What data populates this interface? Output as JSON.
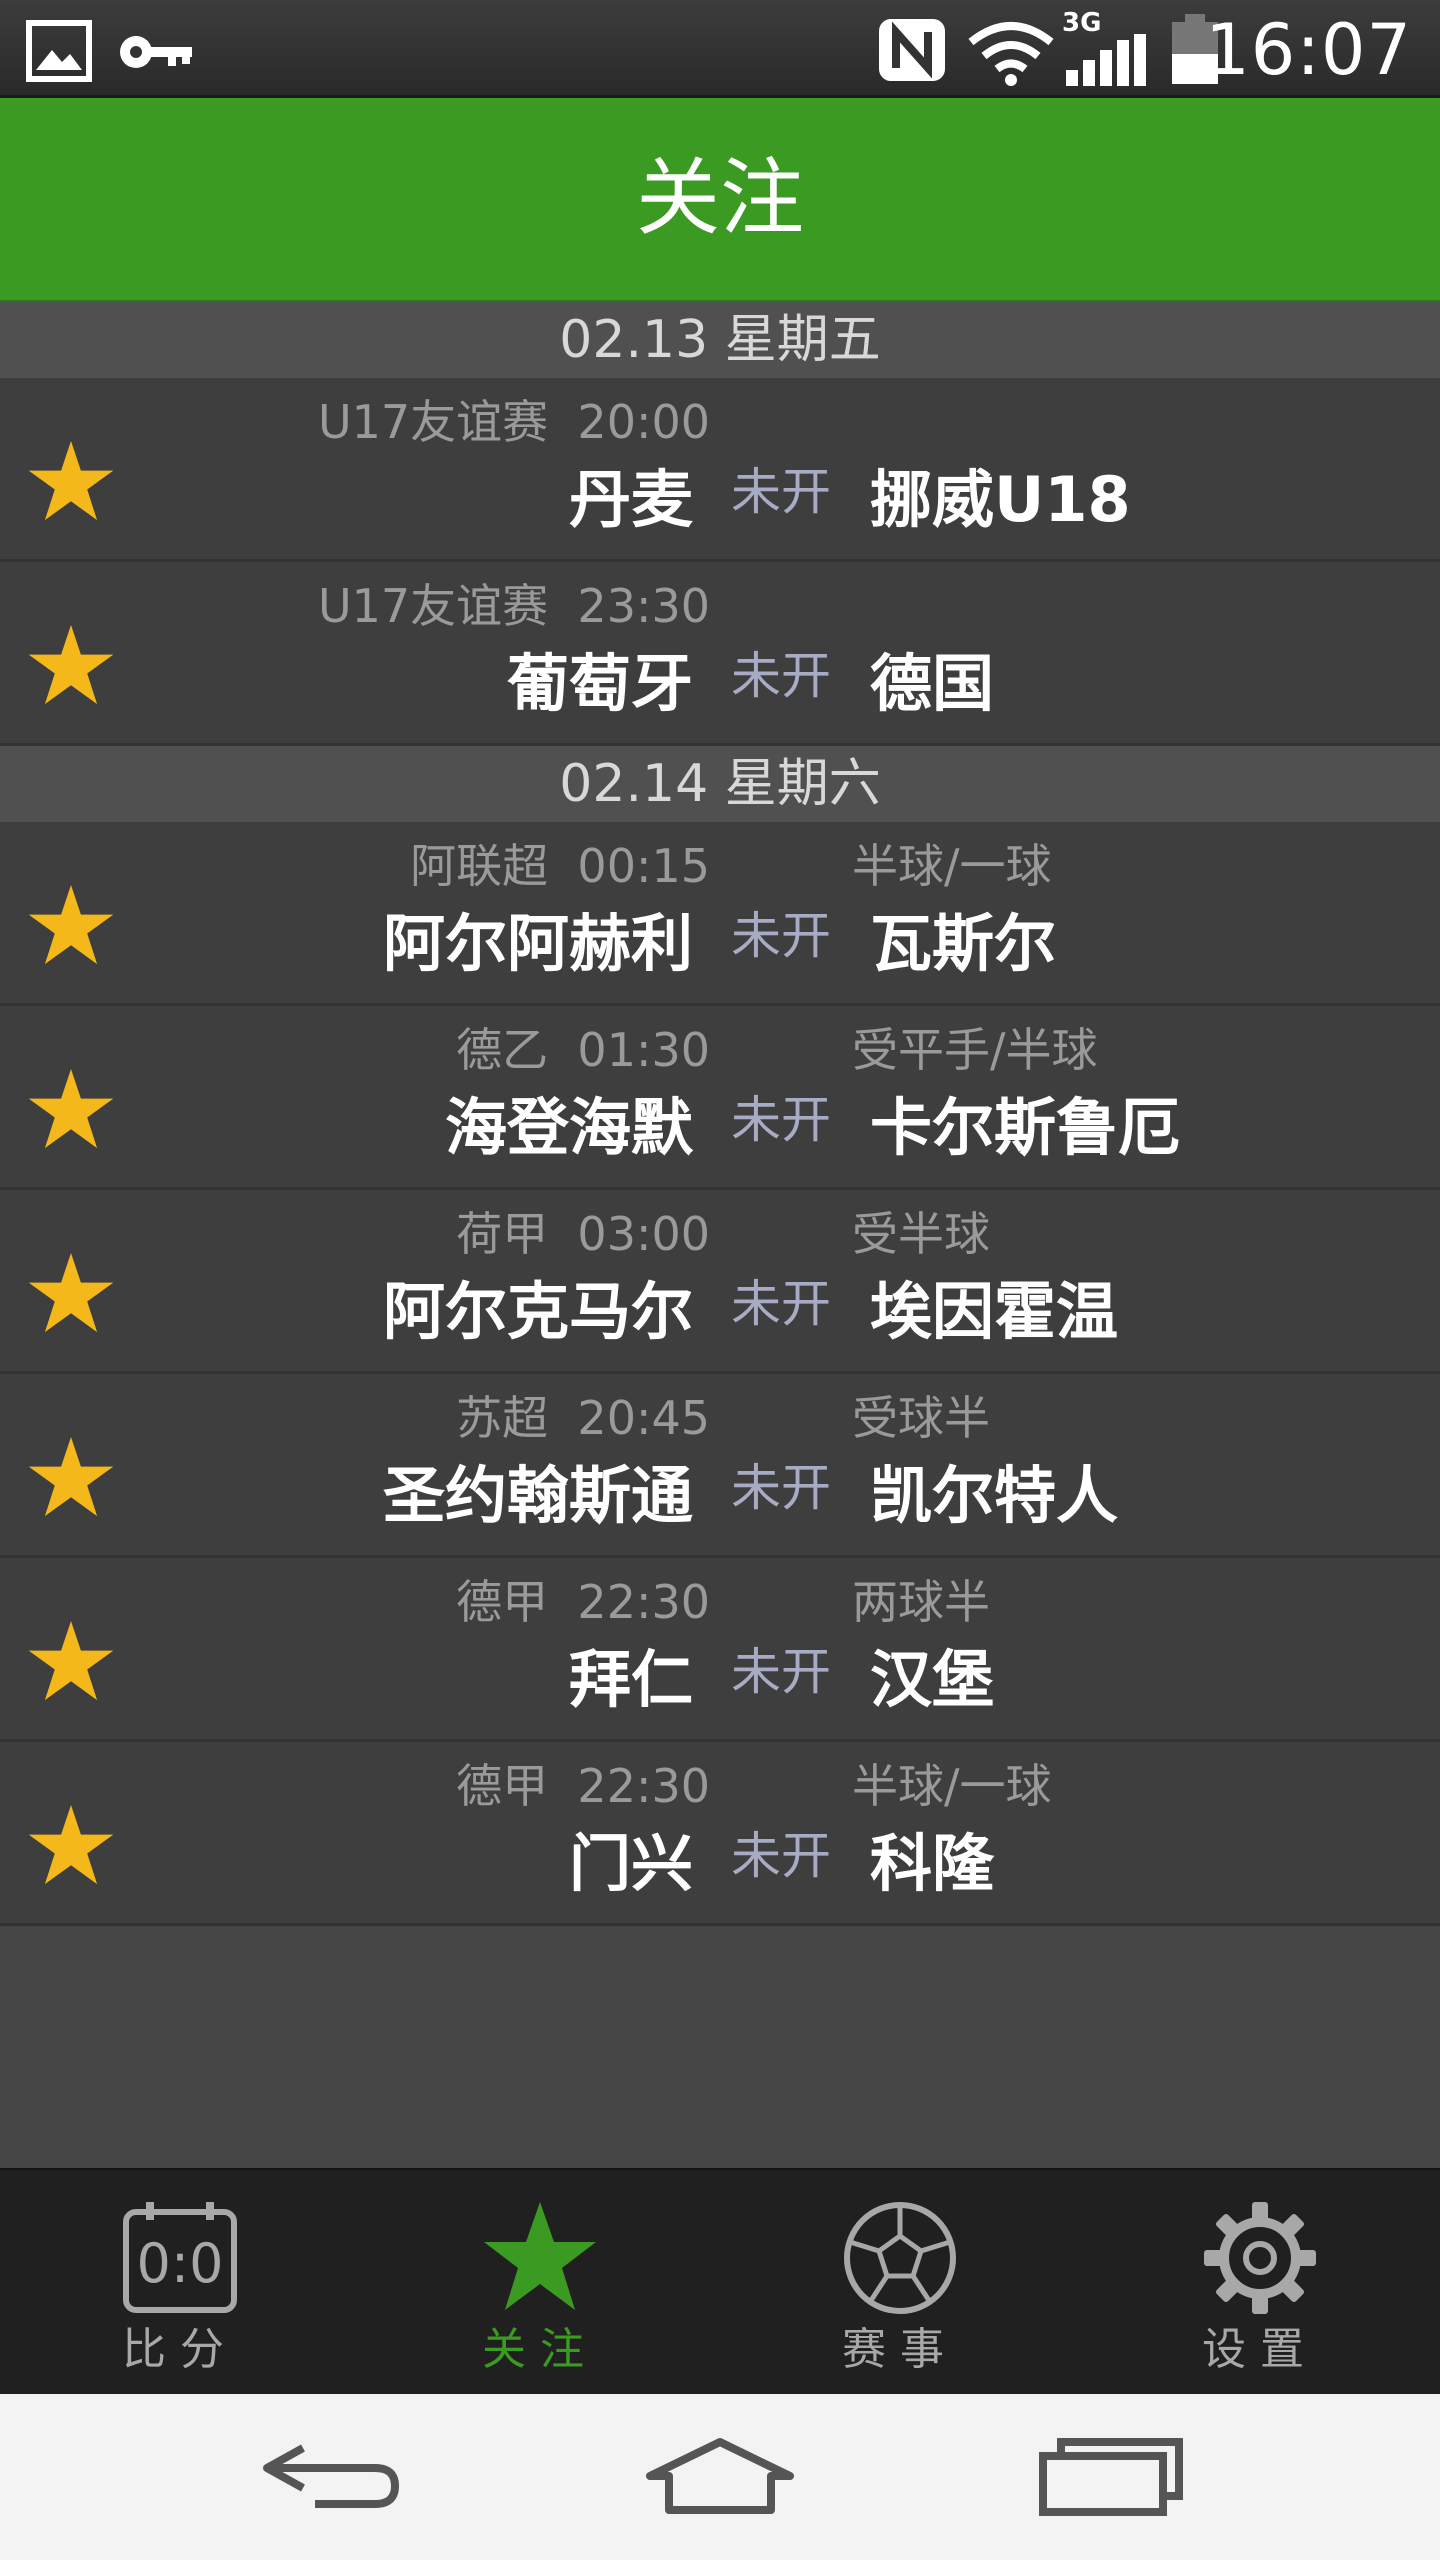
{
  "status_bar": {
    "time": "16:07",
    "network": "3G",
    "icons": [
      "image-icon",
      "key-icon",
      "nfc-icon",
      "wifi-icon",
      "signal-icon",
      "battery-icon"
    ]
  },
  "header": {
    "title": "关注",
    "color": "#3a9a22"
  },
  "sections": [
    {
      "date": "02.13 星期五",
      "matches": [
        {
          "league": "U17友谊赛",
          "time": "20:00",
          "handicap": "",
          "home": "丹麦",
          "status": "未开",
          "away": "挪威U18"
        },
        {
          "league": "U17友谊赛",
          "time": "23:30",
          "handicap": "",
          "home": "葡萄牙",
          "status": "未开",
          "away": "德国"
        }
      ]
    },
    {
      "date": "02.14 星期六",
      "matches": [
        {
          "league": "阿联超",
          "time": "00:15",
          "handicap": "半球/一球",
          "home": "阿尔阿赫利",
          "status": "未开",
          "away": "瓦斯尔"
        },
        {
          "league": "德乙",
          "time": "01:30",
          "handicap": "受平手/半球",
          "home": "海登海默",
          "status": "未开",
          "away": "卡尔斯鲁厄"
        },
        {
          "league": "荷甲",
          "time": "03:00",
          "handicap": "受半球",
          "home": "阿尔克马尔",
          "status": "未开",
          "away": "埃因霍温"
        },
        {
          "league": "苏超",
          "time": "20:45",
          "handicap": "受球半",
          "home": "圣约翰斯通",
          "status": "未开",
          "away": "凯尔特人"
        },
        {
          "league": "德甲",
          "time": "22:30",
          "handicap": "两球半",
          "home": "拜仁",
          "status": "未开",
          "away": "汉堡"
        },
        {
          "league": "德甲",
          "time": "22:30",
          "handicap": "半球/一球",
          "home": "门兴",
          "status": "未开",
          "away": "科隆"
        }
      ]
    }
  ],
  "tabs": [
    {
      "label": "比分",
      "icon": "scoreboard-icon",
      "active": false
    },
    {
      "label": "关注",
      "icon": "star-icon",
      "active": true
    },
    {
      "label": "赛事",
      "icon": "soccer-ball-icon",
      "active": false
    },
    {
      "label": "设置",
      "icon": "gear-icon",
      "active": false
    }
  ],
  "scoreboard_icon_text": "0:0",
  "nav_buttons": [
    "back-icon",
    "home-icon",
    "recents-icon"
  ],
  "colors": {
    "accent": "#3a9a22",
    "star": "#f5b81a",
    "status_text": "#a7acc4"
  }
}
